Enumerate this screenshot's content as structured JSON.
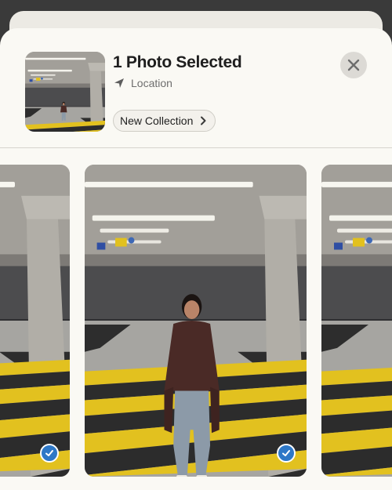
{
  "header": {
    "title": "1 Photo Selected",
    "location_label": "Location",
    "collection_button_label": "New Collection"
  },
  "icons": {
    "location": "location-arrow-icon",
    "collection_chevron": "chevron-right-icon",
    "close": "close-icon",
    "selected": "checkmark-icon"
  },
  "photos": [
    {
      "id": "left",
      "selected": true
    },
    {
      "id": "center",
      "selected": true
    },
    {
      "id": "right",
      "selected": false
    }
  ],
  "colors": {
    "sheet_background": "#faf9f4",
    "selected_badge": "#2e78c7",
    "stripe_yellow": "#e2c11f",
    "stripe_dark": "#2c2c2c"
  }
}
